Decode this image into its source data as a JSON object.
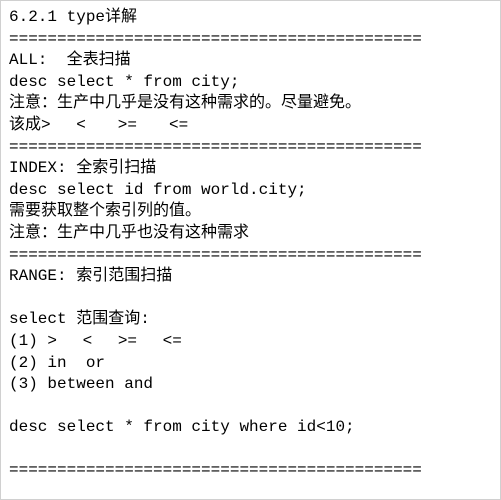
{
  "title": "6.2.1 type详解",
  "sep": "===========================================",
  "all": {
    "header": "ALL:  全表扫描",
    "cmd": "desc select * from city;",
    "note1": "注意：生产中几乎是没有这种需求的。尽量避免。",
    "note2": "该成> 　<　　>=　　<="
  },
  "index": {
    "header": "INDEX: 全索引扫描",
    "cmd": "desc select id from world.city;",
    "note1": "需要获取整个索引列的值。",
    "note2": "注意：生产中几乎也没有这种需求"
  },
  "range": {
    "header": "RANGE: 索引范围扫描",
    "blank": "",
    "subtitle": "select 范围查询:",
    "line1": "(1) > 　< 　>=　 <=",
    "line2": "(2) in  or",
    "line3": "(3) between and",
    "cmd": "desc select * from city where id<10;"
  }
}
